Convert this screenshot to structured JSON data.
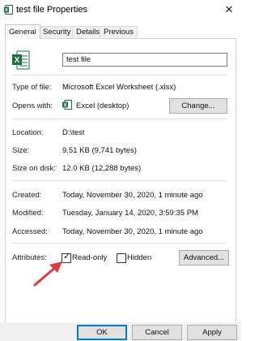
{
  "window": {
    "title": "test file Properties",
    "close_glyph": "✕"
  },
  "tabs": [
    {
      "label": "General",
      "active": true
    },
    {
      "label": "Security"
    },
    {
      "label": "Details"
    },
    {
      "label": "Previous Versions"
    }
  ],
  "file_name": "test file",
  "type_of_file": {
    "label": "Type of file:",
    "value": "Microsoft Excel Worksheet (.xlsx)"
  },
  "opens_with": {
    "label": "Opens with:",
    "value": "Excel (desktop)",
    "change_button": "Change..."
  },
  "location": {
    "label": "Location:",
    "value": "D:\\test"
  },
  "size": {
    "label": "Size:",
    "value": "9.51 KB (9,741 bytes)"
  },
  "size_on_disk": {
    "label": "Size on disk:",
    "value": "12.0 KB (12,288 bytes)"
  },
  "created": {
    "label": "Created:",
    "value": "Today, November 30, 2020, 1 minute ago"
  },
  "modified": {
    "label": "Modified:",
    "value": "Tuesday, January 14, 2020, 3:59:35 PM"
  },
  "accessed": {
    "label": "Accessed:",
    "value": "Today, November 30, 2020, 1 minute ago"
  },
  "attributes": {
    "label": "Attributes:",
    "read_only": {
      "label": "Read-only",
      "checked": true
    },
    "hidden": {
      "label": "Hidden",
      "checked": false
    },
    "advanced_button": "Advanced..."
  },
  "footer": {
    "ok": "OK",
    "cancel": "Cancel",
    "apply": "Apply"
  },
  "colors": {
    "excel_green": "#1e7145",
    "arrow_red": "#e0393e",
    "accent_blue": "#0078d7"
  },
  "icons": [
    "excel-app-icon",
    "excel-file-icon",
    "excel-small-icon",
    "close-icon",
    "annotation-arrow"
  ]
}
